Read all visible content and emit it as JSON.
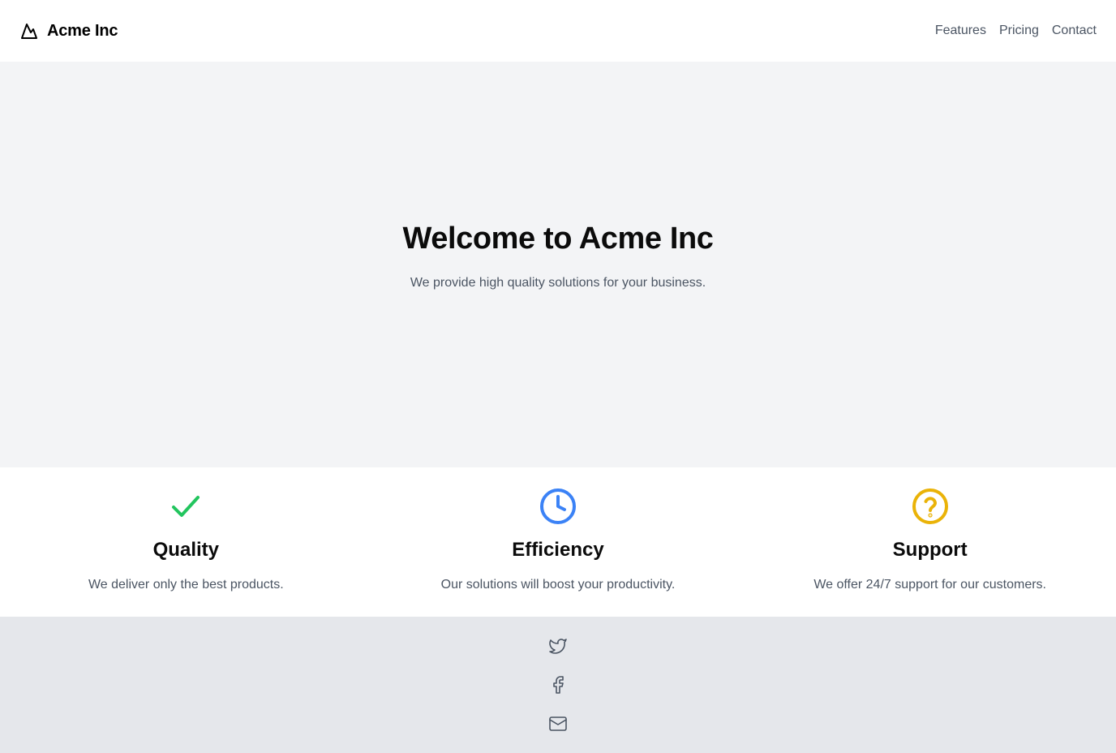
{
  "header": {
    "brand_name": "Acme Inc",
    "brand_icon": "mountain-icon",
    "nav": [
      {
        "label": "Features"
      },
      {
        "label": "Pricing"
      },
      {
        "label": "Contact"
      }
    ]
  },
  "hero": {
    "title": "Welcome to Acme Inc",
    "subtitle": "We provide high quality solutions for your business."
  },
  "features": [
    {
      "icon": "check-icon",
      "color": "#22c55e",
      "title": "Quality",
      "description": "We deliver only the best products."
    },
    {
      "icon": "clock-icon",
      "color": "#3b82f6",
      "title": "Efficiency",
      "description": "Our solutions will boost your productivity."
    },
    {
      "icon": "help-circle-icon",
      "color": "#eab308",
      "title": "Support",
      "description": "We offer 24/7 support for our customers."
    }
  ],
  "footer": {
    "icons": [
      "twitter-icon",
      "facebook-icon",
      "mail-icon"
    ]
  }
}
